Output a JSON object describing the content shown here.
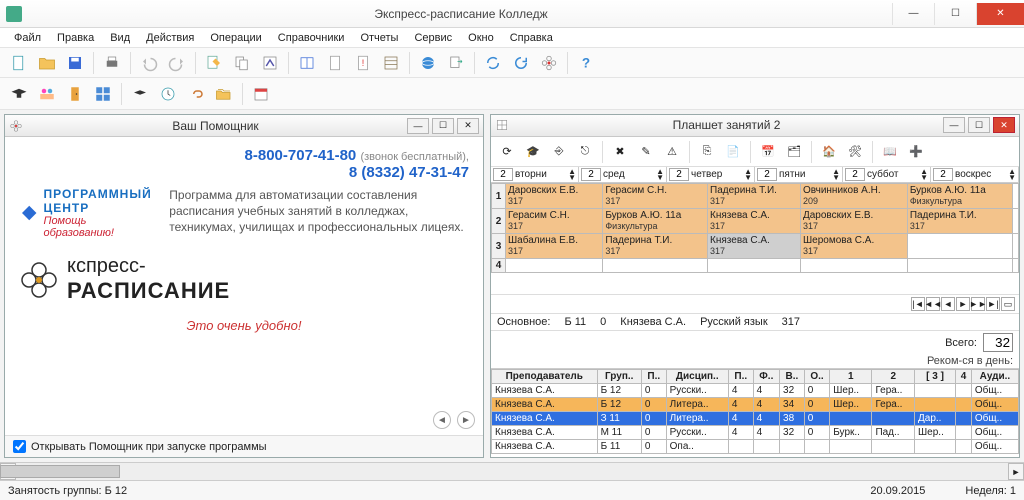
{
  "window": {
    "title": "Экспресс-расписание Колледж"
  },
  "menu": [
    "Файл",
    "Правка",
    "Вид",
    "Действия",
    "Операции",
    "Справочники",
    "Отчеты",
    "Сервис",
    "Окно",
    "Справка"
  ],
  "helper": {
    "title": "Ваш Помощник",
    "phone_main": "8-800-707-41-80",
    "phone_free": "(звонок бесплатный),",
    "phone_alt": "8 (8332) 47-31-47",
    "company_line1": "ПРОГРАММНЫЙ ЦЕНТР",
    "company_line2": "Помощь образованию!",
    "description": "Программа для автоматизации составления расписания учебных занятий в колледжах, техникумах, училищах и профессиональных лицеях.",
    "logo_line1": "кспресс-",
    "logo_line2": "РАСПИСАНИЕ",
    "slogan": "Это очень удобно!",
    "open_on_start": "Открывать Помощник при запуске программы",
    "open_on_start_checked": true
  },
  "board": {
    "title": "Планшет занятий 2",
    "days": [
      {
        "n": "2",
        "name": "вторни"
      },
      {
        "n": "2",
        "name": "сред"
      },
      {
        "n": "2",
        "name": "четвер"
      },
      {
        "n": "2",
        "name": "пятни"
      },
      {
        "n": "2",
        "name": "суббот"
      },
      {
        "n": "2",
        "name": "воскрес"
      }
    ],
    "rows": [
      {
        "n": "1",
        "cells": [
          {
            "t": "Даровских Е.В.",
            "r": "317",
            "c": "cell-top"
          },
          {
            "t": "Герасим С.Н.",
            "r": "317",
            "c": "cell-top"
          },
          {
            "t": "Падерина Т.И.",
            "r": "317",
            "c": "cell-top"
          },
          {
            "t": "Овчинников А.Н.",
            "r": "209",
            "c": "cell-top"
          },
          {
            "t": "Бурков А.Ю.   11а",
            "r": "Физкультура",
            "c": "cell-top"
          },
          {
            "t": "",
            "r": "",
            "c": ""
          }
        ]
      },
      {
        "n": "2",
        "cells": [
          {
            "t": "Герасим С.Н.",
            "r": "317",
            "c": "cell-top"
          },
          {
            "t": "Бурков А.Ю.   11а",
            "r": "Физкультура",
            "c": "cell-top"
          },
          {
            "t": "Князева С.А.",
            "r": "317",
            "c": "cell-top"
          },
          {
            "t": "Даровских Е.В.",
            "r": "317",
            "c": "cell-top"
          },
          {
            "t": "Падерина Т.И.",
            "r": "317",
            "c": "cell-top"
          },
          {
            "t": "",
            "r": "",
            "c": ""
          }
        ]
      },
      {
        "n": "3",
        "cells": [
          {
            "t": "Шабалина Е.В.",
            "r": "317",
            "c": "cell-top"
          },
          {
            "t": "Падерина Т.И.",
            "r": "317",
            "c": "cell-top"
          },
          {
            "t": "Князева С.А.",
            "r": "317",
            "c": "cell-sel"
          },
          {
            "t": "Шеромова С.А.",
            "r": "317",
            "c": "cell-top"
          },
          {
            "t": "",
            "r": "",
            "c": ""
          },
          {
            "t": "",
            "r": "",
            "c": ""
          }
        ]
      },
      {
        "n": "4",
        "cells": [
          {
            "t": "",
            "r": "",
            "c": ""
          },
          {
            "t": "",
            "r": "",
            "c": ""
          },
          {
            "t": "",
            "r": "",
            "c": ""
          },
          {
            "t": "",
            "r": "",
            "c": ""
          },
          {
            "t": "",
            "r": "",
            "c": ""
          },
          {
            "t": "",
            "r": "",
            "c": ""
          }
        ]
      }
    ],
    "info": {
      "label1": "Основное:",
      "group": "Б 11",
      "zero": "0",
      "teacher": "Князева С.А.",
      "subject": "Русский язык",
      "room": "317"
    },
    "total_label": "Всего:",
    "total_value": "32",
    "recom": "Реком-ся в день:",
    "table": {
      "headers": [
        "Преподаватель",
        "Груп..",
        "П..",
        "Дисцип..",
        "П..",
        "Ф..",
        "В..",
        "О..",
        "1",
        "2",
        "[ 3 ]",
        "4",
        "Ауди.."
      ],
      "rows": [
        {
          "cls": "",
          "c": [
            "Князева С.А.",
            "Б 12",
            "0",
            "Русски..",
            "4",
            "4",
            "32",
            "0",
            "Шер..",
            "Гера..",
            "",
            "",
            "Общ.."
          ]
        },
        {
          "cls": "sel",
          "c": [
            "Князева С.А.",
            "Б 12",
            "0",
            "Литера..",
            "4",
            "4",
            "34",
            "0",
            "Шер..",
            "Гера..",
            "",
            "",
            "Общ.."
          ]
        },
        {
          "cls": "hi",
          "c": [
            "Князева С.А.",
            "З 11",
            "0",
            "Литера..",
            "4",
            "4",
            "38",
            "0",
            "",
            "",
            "Дар..",
            "",
            "Общ.."
          ]
        },
        {
          "cls": "",
          "c": [
            "Князева С.А.",
            "М 11",
            "0",
            "Русски..",
            "4",
            "4",
            "32",
            "0",
            "Бурк..",
            "Пад..",
            "Шер..",
            "",
            "Общ.."
          ]
        },
        {
          "cls": "",
          "c": [
            "Князева С.А.",
            "Б 11",
            "0",
            "Опа..",
            "",
            "",
            "",
            "",
            "",
            "",
            "",
            "",
            "Общ.."
          ]
        }
      ]
    }
  },
  "status": {
    "busy": "Занятость группы: Б 12",
    "date": "20.09.2015",
    "week": "Неделя: 1"
  }
}
